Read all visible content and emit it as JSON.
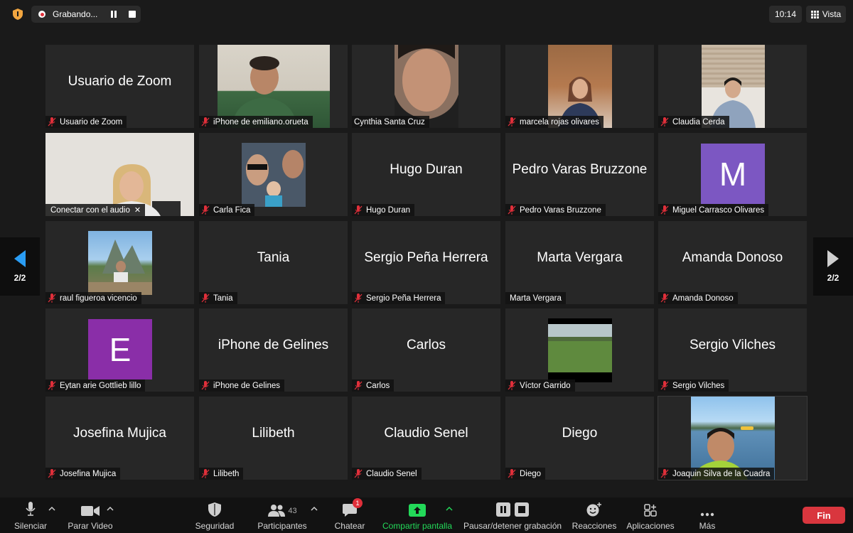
{
  "topbar": {
    "recording_label": "Grabando...",
    "clock": "10:14",
    "view_label": "Vista"
  },
  "pager": {
    "left": "2/2",
    "right": "2/2"
  },
  "tiles": [
    {
      "center": "Usuario de Zoom",
      "tag": "Usuario de Zoom"
    },
    {
      "center": "",
      "tag": "iPhone de emiliano.orueta"
    },
    {
      "center": "",
      "tag": "Cynthia Santa Cruz"
    },
    {
      "center": "",
      "tag": "marcela rojas olivares"
    },
    {
      "center": "",
      "tag": "Claudia Cerda"
    },
    {
      "center": "",
      "tag": "Conectar con el audio"
    },
    {
      "center": "",
      "tag": "Carla Fica"
    },
    {
      "center": "Hugo Duran",
      "tag": "Hugo Duran"
    },
    {
      "center": "Pedro Varas Bruzzone",
      "tag": "Pedro Varas Bruzzone"
    },
    {
      "center": "",
      "tag": "Miguel Carrasco Olivares",
      "avatar": "M",
      "avatar_color": "#7c57c2"
    },
    {
      "center": "",
      "tag": "raul figueroa vicencio"
    },
    {
      "center": "Tania",
      "tag": "Tania"
    },
    {
      "center": "Sergio Peña Herrera",
      "tag": "Sergio Peña Herrera"
    },
    {
      "center": "Marta Vergara",
      "tag": "Marta Vergara"
    },
    {
      "center": "Amanda Donoso",
      "tag": "Amanda Donoso"
    },
    {
      "center": "",
      "tag": "Eytan arie Gottlieb lillo",
      "avatar": "E",
      "avatar_color": "#8a2ea8"
    },
    {
      "center": "iPhone de Gelines",
      "tag": "iPhone de Gelines"
    },
    {
      "center": "Carlos",
      "tag": "Carlos"
    },
    {
      "center": "",
      "tag": "Víctor Garrido"
    },
    {
      "center": "Sergio Vilches",
      "tag": "Sergio Vilches"
    },
    {
      "center": "Josefina Mujica",
      "tag": "Josefina Mujica"
    },
    {
      "center": "Lilibeth",
      "tag": "Lilibeth"
    },
    {
      "center": "Claudio Senel",
      "tag": "Claudio Senel"
    },
    {
      "center": "Diego",
      "tag": "Diego"
    },
    {
      "center": "",
      "tag": "Joaquin Silva de la Cuadra"
    }
  ],
  "toolbar": {
    "mute": "Silenciar",
    "video": "Parar Video",
    "security": "Seguridad",
    "participants": "Participantes",
    "participants_count": "43",
    "chat": "Chatear",
    "chat_badge": "1",
    "share": "Compartir pantalla",
    "record": "Pausar/detener grabación",
    "reactions": "Reacciones",
    "apps": "Aplicaciones",
    "more": "Más",
    "end": "Fin"
  },
  "colors": {
    "share_green": "#23d959",
    "end_red": "#d9363e",
    "record_red": "#e02f3a"
  }
}
